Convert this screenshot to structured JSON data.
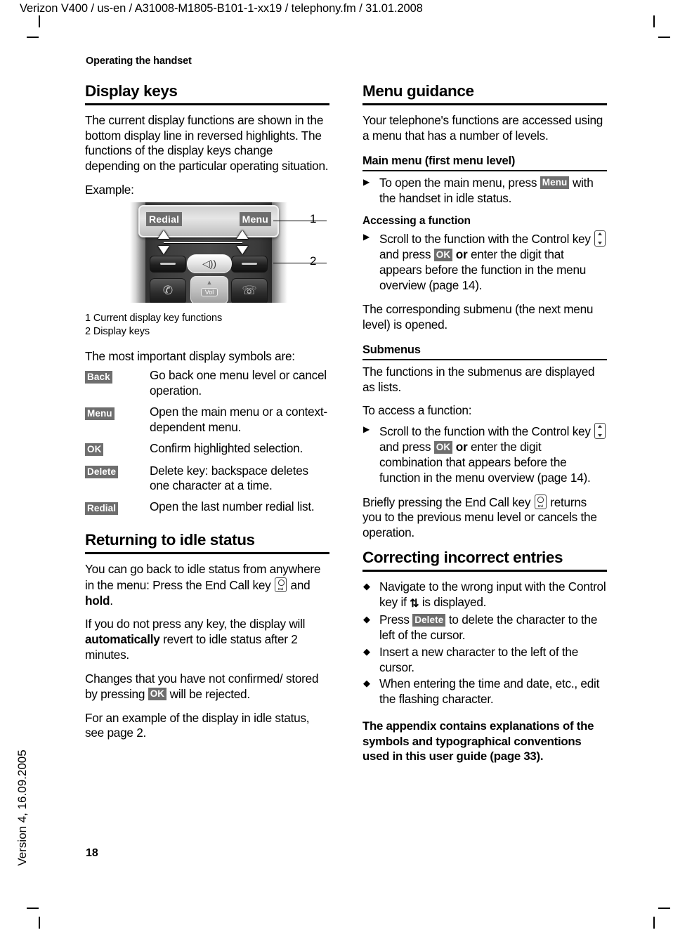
{
  "page": {
    "doc_header": "Verizon V400 / us-en / A31008-M1805-B101-1-xx19 / telephony.fm / 31.01.2008",
    "running_head": "Operating the handset",
    "side_version": "Version 4, 16.09.2005",
    "page_number": "18"
  },
  "left": {
    "h1": "Display keys",
    "intro": "The current display functions are shown in the bottom display line in reversed highlights. The functions of the display keys change depending on the particular operating situation.",
    "example_label": "Example:",
    "figure": {
      "screen_left_key": "Redial",
      "screen_right_key": "Menu",
      "speaker_icon": "speaker-icon",
      "call_icon": "call-key-icon",
      "endcall_icon": "end-call-key-icon",
      "vol_label": "Vol",
      "callout_1": "1",
      "callout_2": "2",
      "legend_1": "1 Current display key functions",
      "legend_2": "2 Display keys"
    },
    "symbols_intro": "The most important display symbols are:",
    "symbols": [
      {
        "key": "Back",
        "desc": "Go back one menu level or cancel operation."
      },
      {
        "key": "Menu",
        "desc": "Open the main menu or a context-dependent menu."
      },
      {
        "key": "OK",
        "desc": "Confirm highlighted selection."
      },
      {
        "key": "Delete",
        "desc": "Delete key: backspace deletes one character at a time."
      },
      {
        "key": "Redial",
        "desc": "Open the last number redial list."
      }
    ],
    "idle": {
      "h1": "Returning to idle status",
      "p1_a": "You can go back to idle status from anywhere in the menu: Press the End Call key",
      "p1_b": "and",
      "p1_bold": "hold",
      "p1_c": ".",
      "p2_a": "If you do not press any key, the display will",
      "p2_bold": "automatically",
      "p2_b": "revert to idle status after 2 minutes.",
      "p3_a": "Changes that you have not confirmed/ stored by pressing",
      "p3_key": "OK",
      "p3_b": "will be rejected.",
      "p4": "For an example of the display in idle status, see page 2."
    }
  },
  "right": {
    "h1": "Menu guidance",
    "intro": "Your telephone's functions are accessed using a menu that has a number of levels.",
    "main_menu": {
      "h2": "Main menu (first menu level)",
      "item_a": "To open the main menu, press",
      "item_key": "Menu",
      "item_b": "with the handset in idle status."
    },
    "accessing": {
      "h3": "Accessing a function",
      "item_a": "Scroll to the function with the Control key",
      "item_b": "and press",
      "item_key": "OK",
      "item_or": "or",
      "item_c": "enter the digit that appears before the function in the menu overview (page 14).",
      "after": "The corresponding submenu (the next menu level) is opened."
    },
    "submenus": {
      "h2": "Submenus",
      "p1": "The functions in the submenus are displayed as lists.",
      "p2": "To access a function:",
      "item_a": "Scroll to the function with the Control key",
      "item_b": "and press",
      "item_key": "OK",
      "item_or": "or",
      "item_c": "enter the digit combination that appears before the function in the menu overview (page 14).",
      "after_a": "Briefly pressing the End Call key",
      "after_b": "returns you to the previous menu level or cancels the operation."
    },
    "correcting": {
      "h1": "Correcting incorrect entries",
      "b1_a": "Navigate to the wrong input with the Control key if",
      "b1_glyph": "⇅",
      "b1_b": "is displayed.",
      "b2_a": "Press",
      "b2_key": "Delete",
      "b2_b": "to delete the character to the left of the cursor.",
      "b3": "Insert a new character to the left of the cursor.",
      "b4": "When entering the time and date, etc., edit the flashing character.",
      "note": "The appendix contains explanations of the symbols and typographical conventions used in this user guide (page 33)."
    }
  },
  "bullets": {
    "arrow": "▶",
    "diamond": "◆"
  },
  "colors": {
    "badge_bg": "#6e6e6e",
    "badge_fg": "#ffffff",
    "rule": "#000000"
  }
}
